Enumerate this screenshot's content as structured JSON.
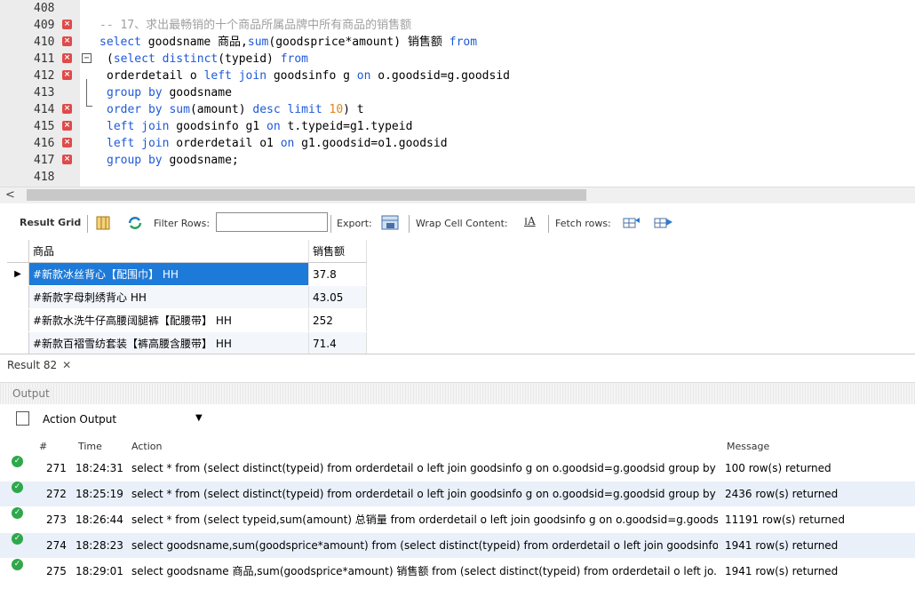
{
  "editor": {
    "lines": [
      {
        "num": "408",
        "err": false,
        "parts": []
      },
      {
        "num": "409",
        "err": true,
        "parts": [
          {
            "t": "-- 17、求出最畅销的十个商品所属品牌中所有商品的销售额",
            "c": "cmt"
          }
        ]
      },
      {
        "num": "410",
        "err": true,
        "parts": [
          {
            "t": "select",
            "c": "kw"
          },
          {
            "t": " goodsname 商品,",
            "c": ""
          },
          {
            "t": "sum",
            "c": "fn"
          },
          {
            "t": "(goodsprice*amount) 销售额 ",
            "c": ""
          },
          {
            "t": "from",
            "c": "kw"
          }
        ]
      },
      {
        "num": "411",
        "err": true,
        "fold": true,
        "parts": [
          {
            "t": "(",
            "c": ""
          },
          {
            "t": "select distinct",
            "c": "kw"
          },
          {
            "t": "(typeid) ",
            "c": ""
          },
          {
            "t": "from",
            "c": "kw"
          }
        ]
      },
      {
        "num": "412",
        "err": true,
        "parts": [
          {
            "t": "orderdetail o ",
            "c": ""
          },
          {
            "t": "left join",
            "c": "kw"
          },
          {
            "t": " goodsinfo g ",
            "c": ""
          },
          {
            "t": "on",
            "c": "kw"
          },
          {
            "t": " o.goodsid=g.goodsid",
            "c": ""
          }
        ]
      },
      {
        "num": "413",
        "err": false,
        "parts": [
          {
            "t": "group by",
            "c": "kw"
          },
          {
            "t": " goodsname",
            "c": ""
          }
        ]
      },
      {
        "num": "414",
        "err": true,
        "parts": [
          {
            "t": "order by",
            "c": "kw"
          },
          {
            "t": " ",
            "c": ""
          },
          {
            "t": "sum",
            "c": "fn"
          },
          {
            "t": "(amount) ",
            "c": ""
          },
          {
            "t": "desc limit",
            "c": "kw"
          },
          {
            "t": " ",
            "c": ""
          },
          {
            "t": "10",
            "c": "num"
          },
          {
            "t": ") t",
            "c": ""
          }
        ]
      },
      {
        "num": "415",
        "err": true,
        "parts": [
          {
            "t": "left join",
            "c": "kw"
          },
          {
            "t": " goodsinfo g1 ",
            "c": ""
          },
          {
            "t": "on",
            "c": "kw"
          },
          {
            "t": " t.typeid=g1.typeid",
            "c": ""
          }
        ]
      },
      {
        "num": "416",
        "err": true,
        "parts": [
          {
            "t": "left join",
            "c": "kw"
          },
          {
            "t": " orderdetail o1 ",
            "c": ""
          },
          {
            "t": "on",
            "c": "kw"
          },
          {
            "t": " g1.goodsid=o1.goodsid",
            "c": ""
          }
        ]
      },
      {
        "num": "417",
        "err": true,
        "parts": [
          {
            "t": "group by",
            "c": "kw"
          },
          {
            "t": " goodsname;",
            "c": ""
          }
        ]
      },
      {
        "num": "418",
        "err": false,
        "parts": []
      }
    ]
  },
  "toolbar": {
    "result_grid": "Result Grid",
    "filter_rows": "Filter Rows:",
    "export": "Export:",
    "wrap": "Wrap Cell Content:",
    "fetch": "Fetch rows:"
  },
  "grid": {
    "headers": [
      "商品",
      "销售额"
    ],
    "rows": [
      [
        "#新款冰丝背心【配围巾】  HH",
        "37.8"
      ],
      [
        "#新款字母刺绣背心  HH",
        "43.05"
      ],
      [
        "#新款水洗牛仔高腰阔腿裤【配腰带】  HH",
        "252"
      ],
      [
        "#新款百褶雪纺套装【裤高腰含腰带】  HH",
        "71.4"
      ]
    ]
  },
  "result_tab": "Result 82",
  "output": {
    "title": "Output",
    "selector": "Action Output",
    "cols": {
      "num": "#",
      "time": "Time",
      "action": "Action",
      "message": "Message"
    },
    "rows": [
      {
        "num": "271",
        "time": "18:24:31",
        "action": "select * from  (select distinct(typeid) from  orderdetail o left join goodsinfo g on o.goodsid=g.goodsid  group by ...",
        "message": "100 row(s) returned"
      },
      {
        "num": "272",
        "time": "18:25:19",
        "action": "select * from  (select distinct(typeid) from  orderdetail o left join goodsinfo g on o.goodsid=g.goodsid  group by ...",
        "message": "2436 row(s) returned"
      },
      {
        "num": "273",
        "time": "18:26:44",
        "action": "select * from (select typeid,sum(amount) 总销量 from  orderdetail o left join goodsinfo g on o.goodsid=g.goodsi...",
        "message": "11191 row(s) returned"
      },
      {
        "num": "274",
        "time": "18:28:23",
        "action": "select goodsname,sum(goodsprice*amount) from  (select distinct(typeid) from  orderdetail o left join goodsinfo g...",
        "message": "1941 row(s) returned"
      },
      {
        "num": "275",
        "time": "18:29:01",
        "action": "select goodsname 商品,sum(goodsprice*amount) 销售额 from  (select distinct(typeid) from  orderdetail o left jo...",
        "message": "1941 row(s) returned"
      }
    ]
  },
  "colors": {
    "keyword": "#1e59d8",
    "comment": "#a0a0a0",
    "number": "#e0841a",
    "selected": "#1e7ad8",
    "success": "#2ea84a"
  }
}
